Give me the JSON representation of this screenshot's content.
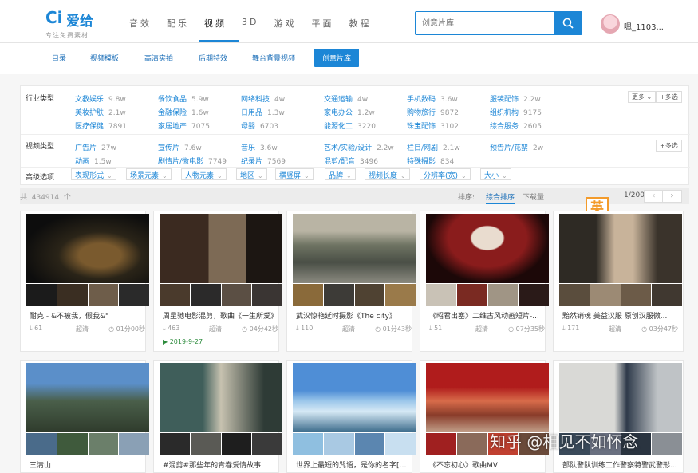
{
  "header": {
    "logo_mark": "Ci",
    "logo_text": "爱给",
    "logo_sub": "专注免费素材",
    "nav": [
      "音效",
      "配乐",
      "视频",
      "3D",
      "游戏",
      "平面",
      "教程"
    ],
    "active_nav": "视频",
    "search_placeholder": "创意片库",
    "username": "嗯_1103..."
  },
  "subnav": {
    "items": [
      "目录",
      "视频模板",
      "高清实拍",
      "后期特效",
      "舞台背景视频",
      "创意片库"
    ],
    "active": "创意片库"
  },
  "filters": {
    "industry": {
      "label": "行业类型",
      "items": [
        {
          "name": "文教娱乐",
          "count": "9.8w"
        },
        {
          "name": "餐饮食品",
          "count": "5.9w"
        },
        {
          "name": "网络科技",
          "count": "4w"
        },
        {
          "name": "交通运输",
          "count": "4w"
        },
        {
          "name": "手机数码",
          "count": "3.6w"
        },
        {
          "name": "服装配饰",
          "count": "2.2w"
        },
        {
          "name": "美妆护肤",
          "count": "2.1w"
        },
        {
          "name": "金融保险",
          "count": "1.6w"
        },
        {
          "name": "日用品",
          "count": "1.3w"
        },
        {
          "name": "家电办公",
          "count": "1.2w"
        },
        {
          "name": "购物旅行",
          "count": "9872"
        },
        {
          "name": "组织机构",
          "count": "9175"
        },
        {
          "name": "医疗保健",
          "count": "7891"
        },
        {
          "name": "家居地产",
          "count": "7075"
        },
        {
          "name": "母婴",
          "count": "6703"
        },
        {
          "name": "能源化工",
          "count": "3220"
        },
        {
          "name": "珠宝配饰",
          "count": "3102"
        },
        {
          "name": "综合服务",
          "count": "2605"
        }
      ],
      "more": "更多",
      "multi": "+多选"
    },
    "video": {
      "label": "视频类型",
      "items": [
        {
          "name": "广告片",
          "count": "27w"
        },
        {
          "name": "宣传片",
          "count": "7.6w"
        },
        {
          "name": "音乐",
          "count": "3.6w"
        },
        {
          "name": "艺术/实验/设计",
          "count": "2.2w"
        },
        {
          "name": "栏目/网剧",
          "count": "2.1w"
        },
        {
          "name": "预告片/花絮",
          "count": "2w"
        },
        {
          "name": "动画",
          "count": "1.5w"
        },
        {
          "name": "剧情片/微电影",
          "count": "7749"
        },
        {
          "name": "纪录片",
          "count": "7569"
        },
        {
          "name": "混剪/配音",
          "count": "3496"
        },
        {
          "name": "特殊摄影",
          "count": "834"
        }
      ],
      "multi": "+多选"
    },
    "advanced": {
      "label": "高级选项",
      "dropdowns": [
        "表现形式",
        "场景元素",
        "人物元素",
        "地区",
        "横竖屏",
        "品牌",
        "视频长度",
        "分辨率(宽)",
        "大小"
      ]
    }
  },
  "sortbar": {
    "total_prefix": "共",
    "total": "434914",
    "total_suffix": "个",
    "sort_label": "排序:",
    "sort_options": [
      "综合排序",
      "下载量"
    ],
    "page": "1/200",
    "prev": "‹",
    "next": "›"
  },
  "ime_badge": "英",
  "cards": [
    {
      "title": "耐克 - &不被我，假我&\"",
      "downloads": "61",
      "quality": "超清",
      "duration": "01分00秒",
      "date": ""
    },
    {
      "title": "周星驰电影混剪，歌曲《一生所爱》",
      "downloads": "463",
      "quality": "超清",
      "duration": "04分42秒",
      "date": "2019-9-27"
    },
    {
      "title": "武汉惊艳延时摄影《The city》",
      "downloads": "110",
      "quality": "超清",
      "duration": "01分43秒",
      "date": ""
    },
    {
      "title": "《昭君出塞》二维古风动画短片-...",
      "downloads": "51",
      "quality": "超清",
      "duration": "07分35秒",
      "date": ""
    },
    {
      "title": "黯然销魂 美益汉服 原创汉服微...",
      "downloads": "171",
      "quality": "超清",
      "duration": "03分47秒",
      "date": ""
    },
    {
      "title": "三清山",
      "downloads": "",
      "quality": "",
      "duration": "",
      "date": ""
    },
    {
      "title": "#混剪#那些年的青春爱情故事",
      "downloads": "",
      "quality": "",
      "duration": "",
      "date": ""
    },
    {
      "title": "世界上最短的咒语，是你的名字[中...",
      "downloads": "",
      "quality": "",
      "duration": "",
      "date": ""
    },
    {
      "title": "《不忘初心》歌曲MV",
      "downloads": "",
      "quality": "",
      "duration": "",
      "date": ""
    },
    {
      "title": "部队警队训练工作警察特警武警形...",
      "downloads": "",
      "quality": "",
      "duration": "",
      "date": ""
    }
  ],
  "watermark": "知乎 @相见不如怀念",
  "colors": {
    "accent": "#1c86d6",
    "ime": "#f39b2b",
    "date_green": "#2a8a3a"
  }
}
